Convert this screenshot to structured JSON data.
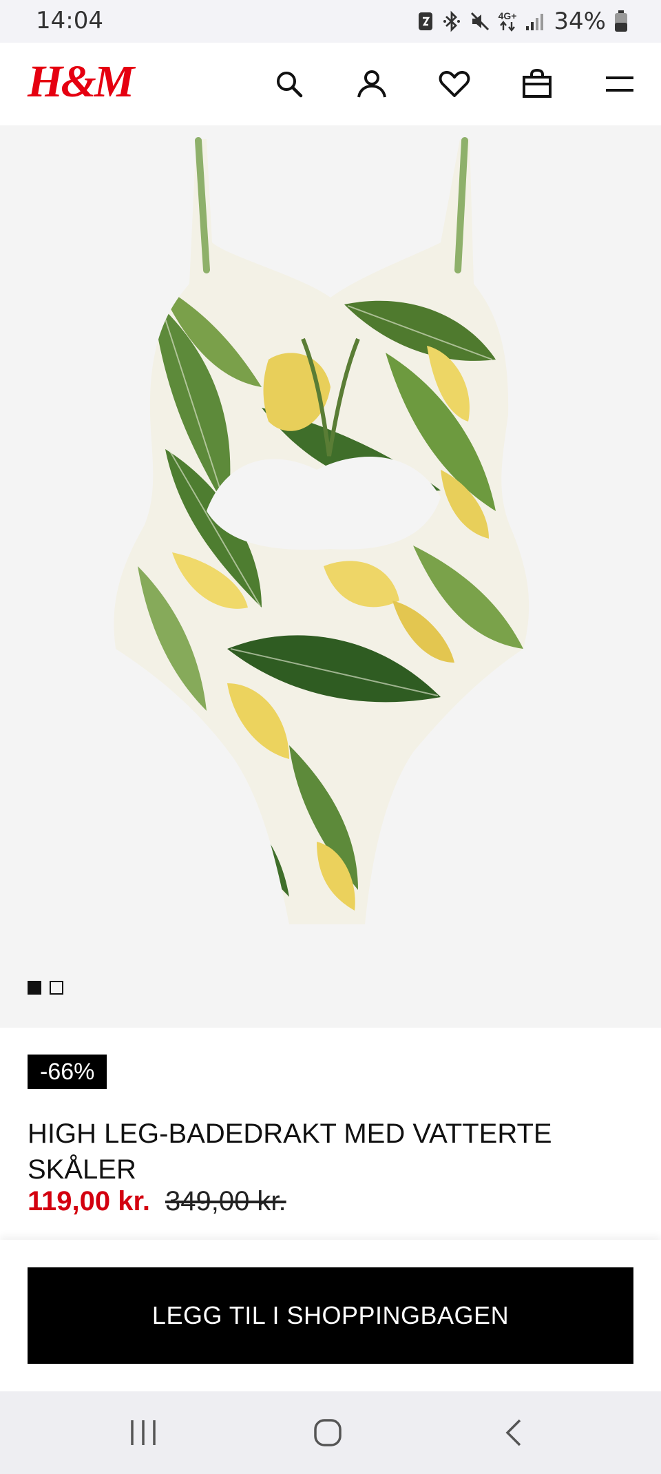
{
  "status": {
    "time": "14:04",
    "battery_percent": "34%",
    "network": "4G+"
  },
  "header": {
    "logo_text": "H&M",
    "icons": [
      "search-icon",
      "account-icon",
      "heart-icon",
      "shopping-bag-icon",
      "menu-icon"
    ],
    "brand_color": "#e50010"
  },
  "gallery": {
    "image_count": 2,
    "active_index": 0
  },
  "product": {
    "discount_badge": "-66%",
    "title": "HIGH LEG-BADEDRAKT MED VATTERTE SKÅLER",
    "sale_price": "119,00 kr.",
    "original_price": "349,00 kr.",
    "sale_color": "#d3000f"
  },
  "cta": {
    "label": "LEGG TIL I SHOPPINGBAGEN"
  },
  "navbar": {
    "icons": [
      "recent-apps-icon",
      "home-icon",
      "back-icon"
    ]
  }
}
